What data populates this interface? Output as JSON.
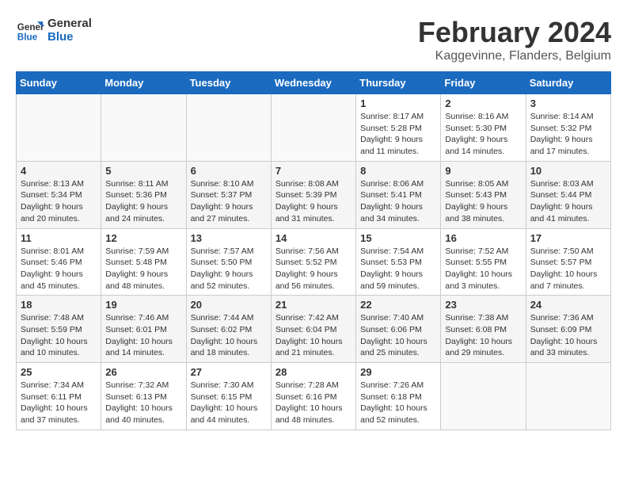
{
  "header": {
    "logo_general": "General",
    "logo_blue": "Blue",
    "main_title": "February 2024",
    "subtitle": "Kaggevinne, Flanders, Belgium"
  },
  "columns": [
    "Sunday",
    "Monday",
    "Tuesday",
    "Wednesday",
    "Thursday",
    "Friday",
    "Saturday"
  ],
  "weeks": [
    [
      {
        "day": "",
        "detail": ""
      },
      {
        "day": "",
        "detail": ""
      },
      {
        "day": "",
        "detail": ""
      },
      {
        "day": "",
        "detail": ""
      },
      {
        "day": "1",
        "detail": "Sunrise: 8:17 AM\nSunset: 5:28 PM\nDaylight: 9 hours\nand 11 minutes."
      },
      {
        "day": "2",
        "detail": "Sunrise: 8:16 AM\nSunset: 5:30 PM\nDaylight: 9 hours\nand 14 minutes."
      },
      {
        "day": "3",
        "detail": "Sunrise: 8:14 AM\nSunset: 5:32 PM\nDaylight: 9 hours\nand 17 minutes."
      }
    ],
    [
      {
        "day": "4",
        "detail": "Sunrise: 8:13 AM\nSunset: 5:34 PM\nDaylight: 9 hours\nand 20 minutes."
      },
      {
        "day": "5",
        "detail": "Sunrise: 8:11 AM\nSunset: 5:36 PM\nDaylight: 9 hours\nand 24 minutes."
      },
      {
        "day": "6",
        "detail": "Sunrise: 8:10 AM\nSunset: 5:37 PM\nDaylight: 9 hours\nand 27 minutes."
      },
      {
        "day": "7",
        "detail": "Sunrise: 8:08 AM\nSunset: 5:39 PM\nDaylight: 9 hours\nand 31 minutes."
      },
      {
        "day": "8",
        "detail": "Sunrise: 8:06 AM\nSunset: 5:41 PM\nDaylight: 9 hours\nand 34 minutes."
      },
      {
        "day": "9",
        "detail": "Sunrise: 8:05 AM\nSunset: 5:43 PM\nDaylight: 9 hours\nand 38 minutes."
      },
      {
        "day": "10",
        "detail": "Sunrise: 8:03 AM\nSunset: 5:44 PM\nDaylight: 9 hours\nand 41 minutes."
      }
    ],
    [
      {
        "day": "11",
        "detail": "Sunrise: 8:01 AM\nSunset: 5:46 PM\nDaylight: 9 hours\nand 45 minutes."
      },
      {
        "day": "12",
        "detail": "Sunrise: 7:59 AM\nSunset: 5:48 PM\nDaylight: 9 hours\nand 48 minutes."
      },
      {
        "day": "13",
        "detail": "Sunrise: 7:57 AM\nSunset: 5:50 PM\nDaylight: 9 hours\nand 52 minutes."
      },
      {
        "day": "14",
        "detail": "Sunrise: 7:56 AM\nSunset: 5:52 PM\nDaylight: 9 hours\nand 56 minutes."
      },
      {
        "day": "15",
        "detail": "Sunrise: 7:54 AM\nSunset: 5:53 PM\nDaylight: 9 hours\nand 59 minutes."
      },
      {
        "day": "16",
        "detail": "Sunrise: 7:52 AM\nSunset: 5:55 PM\nDaylight: 10 hours\nand 3 minutes."
      },
      {
        "day": "17",
        "detail": "Sunrise: 7:50 AM\nSunset: 5:57 PM\nDaylight: 10 hours\nand 7 minutes."
      }
    ],
    [
      {
        "day": "18",
        "detail": "Sunrise: 7:48 AM\nSunset: 5:59 PM\nDaylight: 10 hours\nand 10 minutes."
      },
      {
        "day": "19",
        "detail": "Sunrise: 7:46 AM\nSunset: 6:01 PM\nDaylight: 10 hours\nand 14 minutes."
      },
      {
        "day": "20",
        "detail": "Sunrise: 7:44 AM\nSunset: 6:02 PM\nDaylight: 10 hours\nand 18 minutes."
      },
      {
        "day": "21",
        "detail": "Sunrise: 7:42 AM\nSunset: 6:04 PM\nDaylight: 10 hours\nand 21 minutes."
      },
      {
        "day": "22",
        "detail": "Sunrise: 7:40 AM\nSunset: 6:06 PM\nDaylight: 10 hours\nand 25 minutes."
      },
      {
        "day": "23",
        "detail": "Sunrise: 7:38 AM\nSunset: 6:08 PM\nDaylight: 10 hours\nand 29 minutes."
      },
      {
        "day": "24",
        "detail": "Sunrise: 7:36 AM\nSunset: 6:09 PM\nDaylight: 10 hours\nand 33 minutes."
      }
    ],
    [
      {
        "day": "25",
        "detail": "Sunrise: 7:34 AM\nSunset: 6:11 PM\nDaylight: 10 hours\nand 37 minutes."
      },
      {
        "day": "26",
        "detail": "Sunrise: 7:32 AM\nSunset: 6:13 PM\nDaylight: 10 hours\nand 40 minutes."
      },
      {
        "day": "27",
        "detail": "Sunrise: 7:30 AM\nSunset: 6:15 PM\nDaylight: 10 hours\nand 44 minutes."
      },
      {
        "day": "28",
        "detail": "Sunrise: 7:28 AM\nSunset: 6:16 PM\nDaylight: 10 hours\nand 48 minutes."
      },
      {
        "day": "29",
        "detail": "Sunrise: 7:26 AM\nSunset: 6:18 PM\nDaylight: 10 hours\nand 52 minutes."
      },
      {
        "day": "",
        "detail": ""
      },
      {
        "day": "",
        "detail": ""
      }
    ]
  ]
}
